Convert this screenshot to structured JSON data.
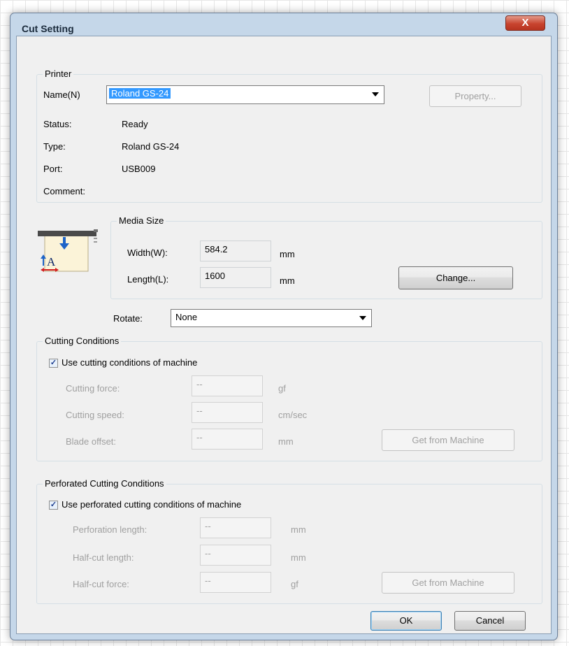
{
  "window": {
    "title": "Cut Setting",
    "close_glyph": "X"
  },
  "printer": {
    "group_label": "Printer",
    "name_label": "Name(N)",
    "name_value": "Roland GS-24",
    "property_button": "Property...",
    "status_label": "Status:",
    "status_value": "Ready",
    "type_label": "Type:",
    "type_value": "Roland GS-24",
    "port_label": "Port:",
    "port_value": "USB009",
    "comment_label": "Comment:"
  },
  "media": {
    "icon": "media-size-icon",
    "group_label": "Media Size",
    "width_label": "Width(W):",
    "width_value": "584.2",
    "width_unit": "mm",
    "length_label": "Length(L):",
    "length_value": "1600",
    "length_unit": "mm",
    "change_button": "Change..."
  },
  "rotate": {
    "label": "Rotate:",
    "value": "None"
  },
  "cutting": {
    "group_label": "Cutting Conditions",
    "checkbox_label": "Use cutting conditions of machine",
    "checked": true,
    "force_label": "Cutting force:",
    "force_value": "--",
    "force_unit": "gf",
    "speed_label": "Cutting speed:",
    "speed_value": "--",
    "speed_unit": "cm/sec",
    "offset_label": "Blade offset:",
    "offset_value": "--",
    "offset_unit": "mm",
    "get_button": "Get from Machine"
  },
  "perforated": {
    "group_label": "Perforated Cutting Conditions",
    "checkbox_label": "Use perforated cutting conditions of machine",
    "checked": true,
    "perf_length_label": "Perforation length:",
    "perf_length_value": "--",
    "perf_length_unit": "mm",
    "halfcut_length_label": "Half-cut length:",
    "halfcut_length_value": "--",
    "halfcut_length_unit": "mm",
    "halfcut_force_label": "Half-cut force:",
    "halfcut_force_value": "--",
    "halfcut_force_unit": "gf",
    "get_button": "Get from Machine"
  },
  "footer": {
    "ok": "OK",
    "cancel": "Cancel"
  },
  "colors": {
    "selection": "#3399ff",
    "close_button": "#c8442f",
    "dialog_bg": "#f0f0f0"
  }
}
